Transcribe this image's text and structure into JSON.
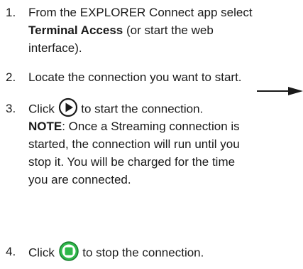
{
  "steps": [
    {
      "number": "1.",
      "line1_prefix": "From the EXPLORER Connect app select",
      "line2_bold": "Terminal Access",
      "line2_suffix": " (or start the web",
      "line3": "interface)."
    },
    {
      "number": "2.",
      "text": "Locate the connection you want to start."
    },
    {
      "number": "3.",
      "before_icon": "Click ",
      "after_icon": " to start the connection.",
      "note_label": "NOTE",
      "note_line1": ": Once a Streaming connection is",
      "note_line2": "started, the connection will run until you",
      "note_line3": "stop it. You will be charged for the time",
      "note_line4": "you are connected."
    },
    {
      "number": "4.",
      "before_icon": "Click ",
      "after_icon": " to stop the connection."
    }
  ],
  "icons": {
    "start": "play-icon",
    "stop": "stop-icon",
    "arrow": "arrow-right-icon"
  },
  "colors": {
    "stop_green": "#2fb84a",
    "text": "#1a1a1a"
  }
}
